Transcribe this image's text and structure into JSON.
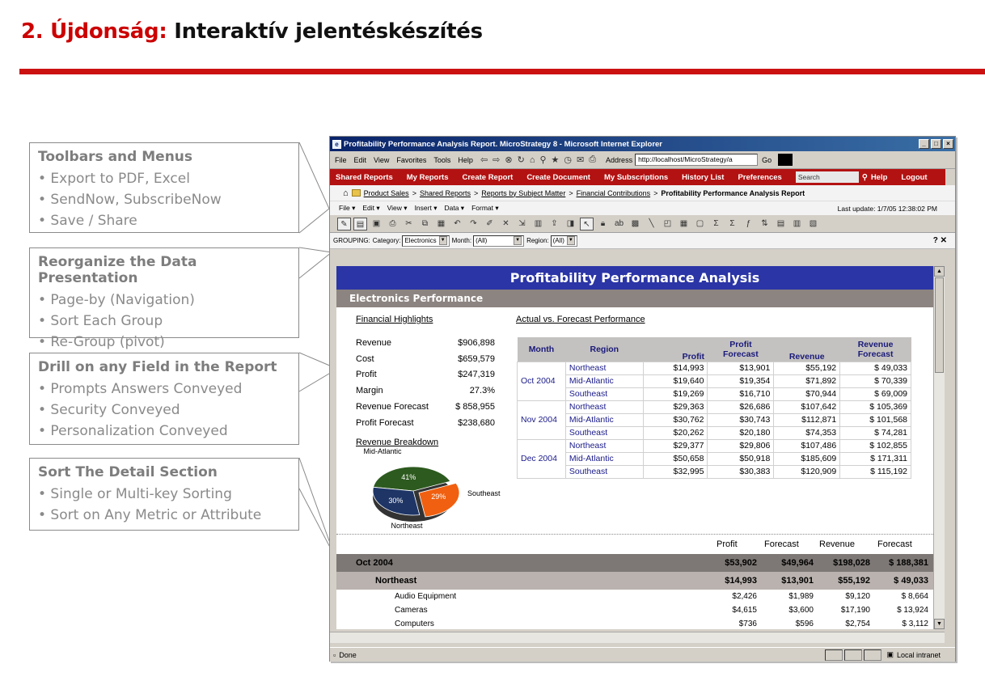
{
  "slide": {
    "title_prefix": "2. Újdonság:",
    "title_rest": "Interaktív jelentéskészítés",
    "accent_color": "#cc1111"
  },
  "callouts": [
    {
      "title": "Toolbars and Menus",
      "items": [
        "• Export to PDF, Excel",
        "• SendNow, SubscribeNow",
        "• Save / Share"
      ]
    },
    {
      "title": "Reorganize the Data Presentation",
      "items": [
        "• Page-by (Navigation)",
        "• Sort Each Group",
        "• Re-Group (pivot)"
      ]
    },
    {
      "title": "Drill on any Field in the Report",
      "items": [
        "• Prompts Answers Conveyed",
        "• Security Conveyed",
        "• Personalization Conveyed"
      ]
    },
    {
      "title": "Sort The Detail Section",
      "items": [
        "• Single or Multi-key Sorting",
        "• Sort on Any Metric or Attribute"
      ]
    }
  ],
  "browser": {
    "title": "Profitability Performance Analysis Report. MicroStrategy 8 - Microsoft Internet Explorer",
    "menu": [
      "File",
      "Edit",
      "View",
      "Favorites",
      "Tools",
      "Help"
    ],
    "address_label": "Address",
    "address_value": "http://localhost/MicroStrategy/a",
    "go_label": "Go",
    "status_text": "Done",
    "zone_text": "Local intranet"
  },
  "app": {
    "nav": [
      "Shared Reports",
      "My Reports",
      "Create Report",
      "Create Document",
      "My Subscriptions",
      "History List",
      "Preferences"
    ],
    "search_placeholder": "Search",
    "help": "Help",
    "logout": "Logout",
    "breadcrumb": [
      "Product Sales",
      "Shared Reports",
      "Reports by Subject Matter",
      "Financial Contributions"
    ],
    "breadcrumb_current": "Profitability Performance Analysis Report",
    "menus": [
      "File",
      "Edit",
      "View",
      "Insert",
      "Data",
      "Format"
    ],
    "last_update": "Last update:  1/7/05 12:38:02 PM",
    "grouping_label": "GROUPING:",
    "category_label": "Category:",
    "category_value": "Electronics",
    "month_label": "Month:",
    "month_value": "(All)",
    "region_label": "Region:",
    "region_value": "(All)",
    "grouping_right": "? ✕"
  },
  "report": {
    "banner": "Profitability Performance Analysis",
    "subtitle": "Electronics Performance",
    "highlights_title": "Financial Highlights",
    "highlights": [
      {
        "k": "Revenue",
        "v": "$906,898"
      },
      {
        "k": "Cost",
        "v": "$659,579"
      },
      {
        "k": "Profit",
        "v": "$247,319"
      },
      {
        "k": "Margin",
        "v": "27.3%"
      },
      {
        "k": "Revenue Forecast",
        "v": "$ 858,955"
      },
      {
        "k": "Profit Forecast",
        "v": "$238,680"
      }
    ],
    "forecast_title": "Actual vs. Forecast Performance",
    "forecast_headers": [
      "Month",
      "Region",
      "Profit",
      "Profit Forecast",
      "Revenue",
      "Revenue Forecast"
    ],
    "forecast_rows": [
      {
        "month": "Oct 2004",
        "regions": [
          [
            "Northeast",
            "$14,993",
            "$13,901",
            "$55,192",
            "$ 49,033"
          ],
          [
            "Mid-Atlantic",
            "$19,640",
            "$19,354",
            "$71,892",
            "$ 70,339"
          ],
          [
            "Southeast",
            "$19,269",
            "$16,710",
            "$70,944",
            "$ 69,009"
          ]
        ]
      },
      {
        "month": "Nov 2004",
        "regions": [
          [
            "Northeast",
            "$29,363",
            "$26,686",
            "$107,642",
            "$ 105,369"
          ],
          [
            "Mid-Atlantic",
            "$30,762",
            "$30,743",
            "$112,871",
            "$ 101,568"
          ],
          [
            "Southeast",
            "$20,262",
            "$20,180",
            "$74,353",
            "$ 74,281"
          ]
        ]
      },
      {
        "month": "Dec 2004",
        "regions": [
          [
            "Northeast",
            "$29,377",
            "$29,806",
            "$107,486",
            "$ 102,855"
          ],
          [
            "Mid-Atlantic",
            "$50,658",
            "$50,918",
            "$185,609",
            "$ 171,311"
          ],
          [
            "Southeast",
            "$32,995",
            "$30,383",
            "$120,909",
            "$ 115,192"
          ]
        ]
      }
    ],
    "breakdown_title": "Revenue Breakdown",
    "pie": {
      "slices": [
        {
          "label": "Mid-Atlantic",
          "pct_label": "41%",
          "value": 41,
          "color": "#2d5a1f"
        },
        {
          "label": "Southeast",
          "pct_label": "29%",
          "value": 29,
          "color": "#f06010"
        },
        {
          "label": "Northeast",
          "pct_label": "30%",
          "value": 30,
          "color": "#1e3566"
        }
      ]
    },
    "detail_headers": [
      "Profit",
      "Forecast",
      "Revenue",
      "Forecast"
    ],
    "detail_rows": [
      {
        "level": 1,
        "label": "Oct 2004",
        "vals": [
          "$53,902",
          "$49,964",
          "$198,028",
          "$ 188,381"
        ]
      },
      {
        "level": 2,
        "label": "Northeast",
        "vals": [
          "$14,993",
          "$13,901",
          "$55,192",
          "$ 49,033"
        ]
      },
      {
        "level": 3,
        "label": "Audio Equipment",
        "vals": [
          "$2,426",
          "$1,989",
          "$9,120",
          "$ 8,664"
        ]
      },
      {
        "level": 3,
        "label": "Cameras",
        "vals": [
          "$4,615",
          "$3,600",
          "$17,190",
          "$ 13,924"
        ]
      },
      {
        "level": 3,
        "label": "Computers",
        "vals": [
          "$736",
          "$596",
          "$2,754",
          "$ 3,112"
        ]
      }
    ]
  }
}
